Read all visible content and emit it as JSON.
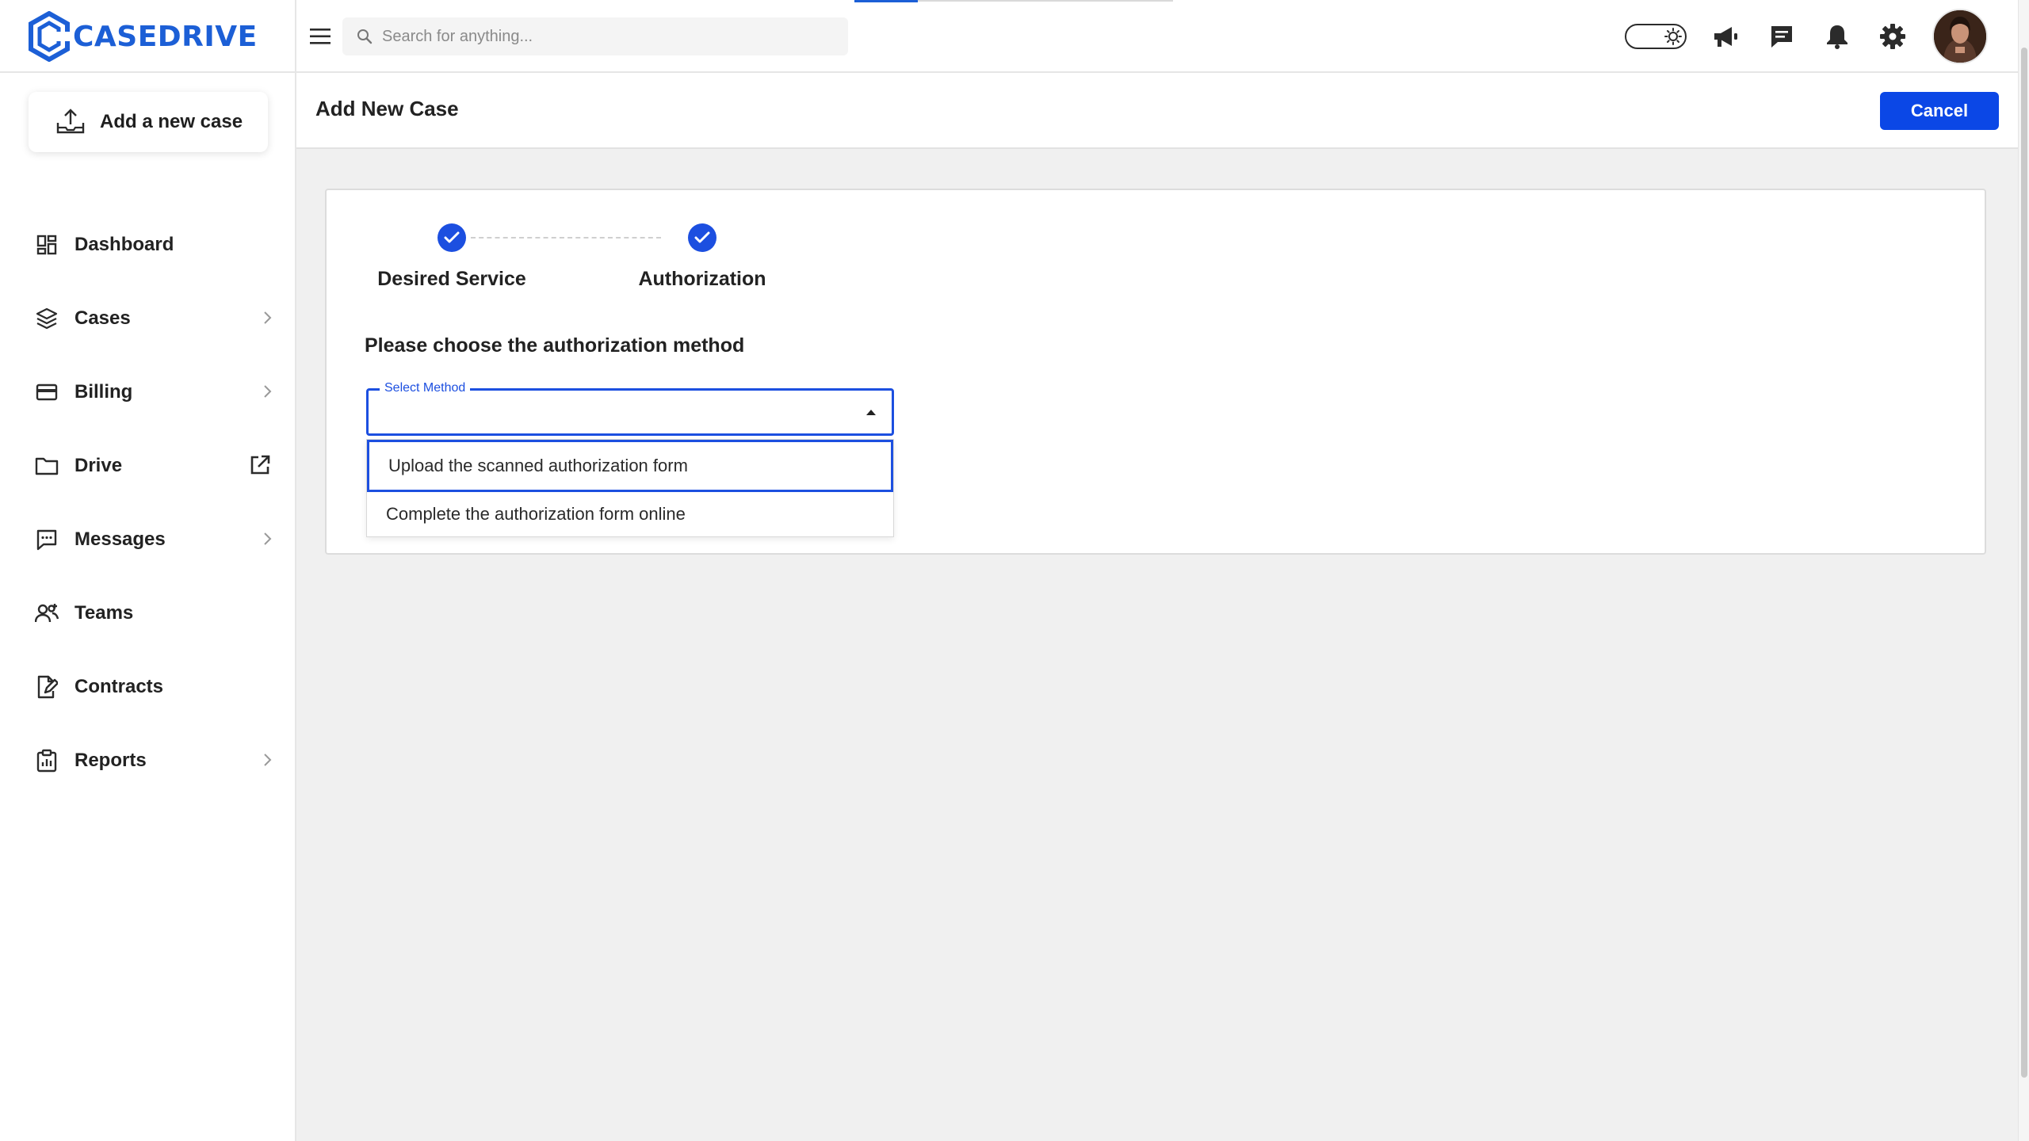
{
  "brand": {
    "name": "CASEDRIVE",
    "color": "#1c5fd6"
  },
  "search": {
    "placeholder": "Search for anything..."
  },
  "header_icons": [
    "theme-toggle-icon",
    "megaphone-icon",
    "chat-icon",
    "bell-icon",
    "gear-icon"
  ],
  "sidebar": {
    "add_case_label": "Add a new case",
    "items": [
      {
        "label": "Dashboard",
        "icon": "dashboard-icon",
        "trailing": ""
      },
      {
        "label": "Cases",
        "icon": "layers-icon",
        "trailing": "chevron"
      },
      {
        "label": "Billing",
        "icon": "card-icon",
        "trailing": "chevron"
      },
      {
        "label": "Drive",
        "icon": "folder-icon",
        "trailing": "external-link"
      },
      {
        "label": "Messages",
        "icon": "message-icon",
        "trailing": "chevron"
      },
      {
        "label": "Teams",
        "icon": "team-icon",
        "trailing": ""
      },
      {
        "label": "Contracts",
        "icon": "contract-icon",
        "trailing": ""
      },
      {
        "label": "Reports",
        "icon": "clipboard-icon",
        "trailing": "chevron"
      }
    ]
  },
  "page": {
    "title": "Add New Case",
    "cancel_label": "Cancel"
  },
  "stepper": {
    "steps": [
      {
        "label": "Desired Service",
        "status": "complete"
      },
      {
        "label": "Authorization",
        "status": "complete"
      }
    ]
  },
  "form": {
    "question": "Please choose the authorization method",
    "select_label": "Select Method",
    "select_value": "",
    "options": [
      "Upload the scanned authorization form",
      "Complete the authorization form online"
    ],
    "highlighted_option_index": 0
  },
  "colors": {
    "primary": "#1c4fe0",
    "cancel_button": "#0b47e6",
    "background": "#f0f0f0"
  }
}
